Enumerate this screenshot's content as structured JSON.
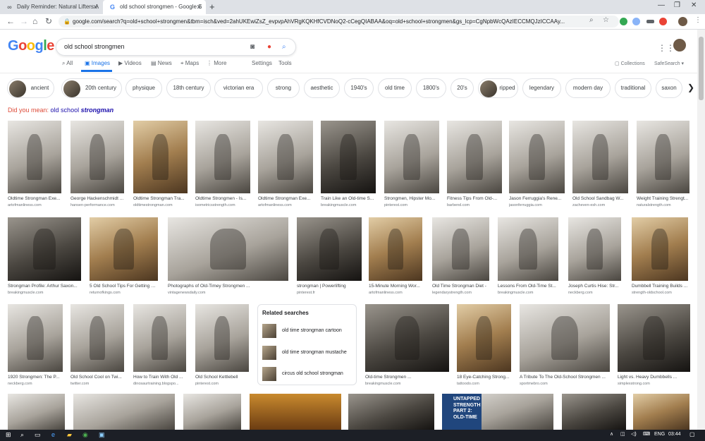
{
  "browser": {
    "tabs": [
      {
        "title": "Daily Reminder: Natural Lifters A",
        "icon": "infinity-icon"
      },
      {
        "title": "old school strongmen - Google S",
        "icon": "google-g-icon"
      }
    ],
    "new_tab": "+",
    "url": "google.com/search?q=old+school+strongmen&tbm=isch&ved=2ahUKEwiZsZ_evpvpAhVRgKQKHfCVDNoQ2-cCegQIABAA&oq=old+school+strongmen&gs_lcp=CgNpbWcQAzIECCMQJzICCAAy..."
  },
  "google": {
    "logo": [
      "G",
      "o",
      "o",
      "g",
      "l",
      "e"
    ],
    "logo_colors": [
      "#4285f4",
      "#ea4335",
      "#fbbc05",
      "#4285f4",
      "#34a853",
      "#ea4335"
    ],
    "query": "old school strongmen",
    "search_tabs": [
      "All",
      "Images",
      "Videos",
      "News",
      "Maps",
      "More",
      "Settings",
      "Tools"
    ],
    "collections": "Collections",
    "safesearch": "SafeSearch"
  },
  "chips": [
    {
      "label": "ancient",
      "has_image": true
    },
    {
      "label": "20th century",
      "has_image": true
    },
    {
      "label": "physique",
      "has_image": false
    },
    {
      "label": "18th century",
      "has_image": false
    },
    {
      "label": "victorian era",
      "has_image": false
    },
    {
      "label": "strong",
      "has_image": false
    },
    {
      "label": "aesthetic",
      "has_image": false
    },
    {
      "label": "1940's",
      "has_image": false
    },
    {
      "label": "old time",
      "has_image": false
    },
    {
      "label": "1800's",
      "has_image": false
    },
    {
      "label": "20's",
      "has_image": false
    },
    {
      "label": "ripped",
      "has_image": true
    },
    {
      "label": "legendary",
      "has_image": false
    },
    {
      "label": "modern day",
      "has_image": false
    },
    {
      "label": "traditional",
      "has_image": false
    },
    {
      "label": "saxon",
      "has_image": false
    }
  ],
  "did_you_mean": {
    "prefix": "Did you mean:",
    "text": "old school",
    "emphasis": "strongman"
  },
  "results_row1": [
    {
      "caption": "Oldtime Strongman Exe...",
      "source": "artofmanliness.com"
    },
    {
      "caption": "George Hackenschmidt ...",
      "source": "hansen-performance.com"
    },
    {
      "caption": "Oldtime Strongman Tra...",
      "source": "oldtimestrongman.com"
    },
    {
      "caption": "Oldtime Strongmen - Is...",
      "source": "isometricsstrength.com"
    },
    {
      "caption": "Oldtime Strongman Exe...",
      "source": "artofmanliness.com"
    },
    {
      "caption": "Train Like an Old-time S...",
      "source": "breakingmuscle.com"
    },
    {
      "caption": "Strongmen, Hipster Mo...",
      "source": "pinterest.com"
    },
    {
      "caption": "Fitness Tips From Old-...",
      "source": "barbend.com"
    },
    {
      "caption": "Jason Ferruggia's Rene...",
      "source": "jasonferruggia.com"
    },
    {
      "caption": "Old School Sandbag W...",
      "source": "zacheven-esh.com"
    },
    {
      "caption": "Weight Training Strengt...",
      "source": "naturalstrength.com"
    }
  ],
  "results_row2": [
    {
      "caption": "Strongman Profile: Arthur Saxon...",
      "source": "breakingmuscle.com"
    },
    {
      "caption": "5 Old School Tips For Getting R...",
      "source": "returnofkings.com"
    },
    {
      "caption": "Photographs of Old-Timey Strongmen ...",
      "source": "vintagenewsdaily.com"
    },
    {
      "caption": "strongman | Powerlifting",
      "source": "pinterest.fr"
    },
    {
      "caption": "15-Minute Morning Wor...",
      "source": "artofmanliness.com"
    },
    {
      "caption": "Old Time Strongman Diet -",
      "source": "legendarystrength.com"
    },
    {
      "caption": "Lessons From Old-Time St...",
      "source": "breakingmuscle.com"
    },
    {
      "caption": "Joseph Curtis Hise: Str...",
      "source": "neckberg.com"
    },
    {
      "caption": "Dumbbell Training Builds ...",
      "source": "strength-oldschool.com"
    }
  ],
  "results_row3": [
    {
      "caption": "1920 Strongmen: The P...",
      "source": "neckberg.com"
    },
    {
      "caption": "Old School Cool on Twi...",
      "source": "twitter.com"
    },
    {
      "caption": "How to Train With Old ...",
      "source": "dinosaurtraining.blogspo..."
    },
    {
      "caption": "Old School Kettlebell",
      "source": "pinterest.com"
    },
    {
      "caption": "Old-time Strongmen ...",
      "source": "breakingmuscle.com"
    },
    {
      "caption": "18 Eye-Catching Strong...",
      "source": "tattoodo.com"
    },
    {
      "caption": "A Tribute To The Old-School Strongmen ...",
      "source": "sportmebro.com"
    },
    {
      "caption": "Light vs. Heavy Dumbbells ...",
      "source": "simplexstrong.com"
    }
  ],
  "related_searches": {
    "title": "Related searches",
    "items": [
      "old time strongman cartoon",
      "old time strongman mustache",
      "circus old school strongman"
    ]
  },
  "row4_text": {
    "banner1": "UNTAPPED",
    "banner2": "STRENGTH",
    "banner3": "PART 2:",
    "banner4": "OLD-TIME"
  },
  "taskbar": {
    "lang": "ENG",
    "time": "03:44"
  }
}
